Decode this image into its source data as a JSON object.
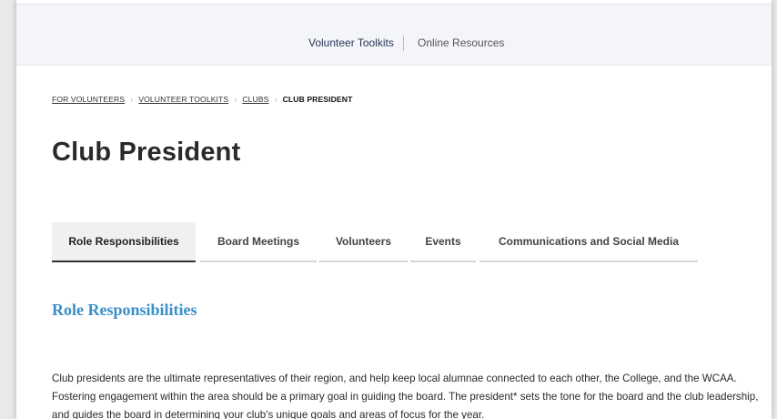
{
  "topnav": {
    "items": [
      {
        "label": "Volunteer Toolkits"
      },
      {
        "label": "Online Resources"
      }
    ]
  },
  "breadcrumb": {
    "items": [
      {
        "label": "FOR VOLUNTEERS"
      },
      {
        "label": "VOLUNTEER TOOLKITS"
      },
      {
        "label": "CLUBS"
      }
    ],
    "current": "CLUB PRESIDENT",
    "separator": "›"
  },
  "page": {
    "title": "Club President"
  },
  "tabs": [
    {
      "label": "Role Responsibilities",
      "active": true
    },
    {
      "label": "Board Meetings",
      "active": false
    },
    {
      "label": "Volunteers",
      "active": false
    },
    {
      "label": "Events",
      "active": false
    },
    {
      "label": "Communications and Social Media",
      "active": false
    }
  ],
  "content": {
    "heading": "Role Responsibilities",
    "paragraph": "Club presidents are the ultimate representatives of their region, and help keep local alumnae connected to each other, the College, and the WCAA. Fostering engagement within the area should be a primary goal in guiding the board. The president* sets the tone for the board and the club leadership, and guides the board in determining your club's unique goals and areas of focus for the year."
  },
  "colors": {
    "accent": "#3a8fc8",
    "nav_bg": "#f3f5f8"
  }
}
